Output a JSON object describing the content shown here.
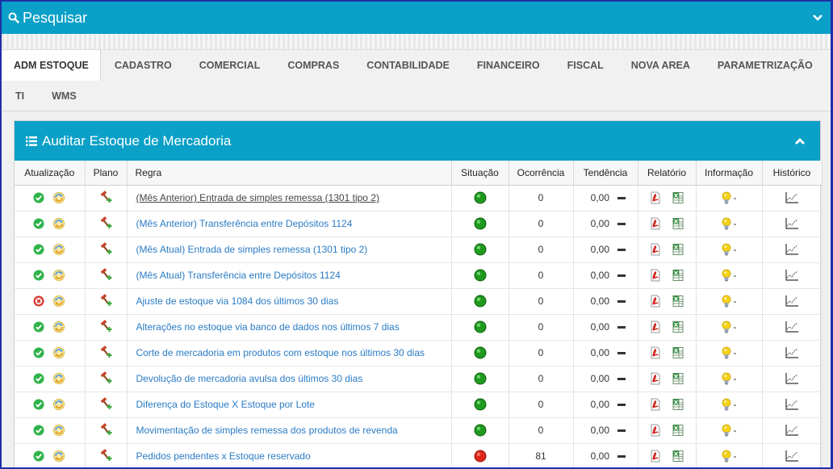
{
  "header": {
    "title": "Pesquisar"
  },
  "tabs": [
    "ADM ESTOQUE",
    "CADASTRO",
    "COMERCIAL",
    "COMPRAS",
    "CONTABILIDADE",
    "FINANCEIRO",
    "FISCAL",
    "NOVA AREA",
    "PARAMETRIZAÇÃO",
    "TI",
    "WMS"
  ],
  "active_tab": "ADM ESTOQUE",
  "panel": {
    "title": "Auditar Estoque de Mercadoria",
    "columns": [
      "Atualização",
      "Plano",
      "Regra",
      "Situação",
      "Ocorrência",
      "Tendência",
      "Relatório",
      "Informação",
      "Histórico"
    ],
    "rows": [
      {
        "status": "ok",
        "regra": "(Mês Anterior) Entrada de simples remessa (1301 tipo 2)",
        "situacao": "green",
        "ocorrencia": "0",
        "tendencia": "0,00",
        "info": "-"
      },
      {
        "status": "ok",
        "regra": "(Mês Anterior) Transferência entre Depósitos 1124",
        "situacao": "green",
        "ocorrencia": "0",
        "tendencia": "0,00",
        "info": "-"
      },
      {
        "status": "ok",
        "regra": "(Mês Atual) Entrada de simples remessa (1301 tipo 2)",
        "situacao": "green",
        "ocorrencia": "0",
        "tendencia": "0,00",
        "info": "-"
      },
      {
        "status": "ok",
        "regra": "(Mês Atual) Transferência entre Depósitos 1124",
        "situacao": "green",
        "ocorrencia": "0",
        "tendencia": "0,00",
        "info": "-"
      },
      {
        "status": "error",
        "regra": "Ajuste de estoque via 1084 dos últimos 30 dias",
        "situacao": "green",
        "ocorrencia": "0",
        "tendencia": "0,00",
        "info": "-"
      },
      {
        "status": "ok",
        "regra": "Alterações no estoque via banco de dados nos últimos 7 dias",
        "situacao": "green",
        "ocorrencia": "0",
        "tendencia": "0,00",
        "info": "-"
      },
      {
        "status": "ok",
        "regra": "Corte de mercadoria em produtos com estoque nos últimos 30 dias",
        "situacao": "green",
        "ocorrencia": "0",
        "tendencia": "0,00",
        "info": "-"
      },
      {
        "status": "ok",
        "regra": "Devolução de mercadoria avulsa dos últimos 30 dias",
        "situacao": "green",
        "ocorrencia": "0",
        "tendencia": "0,00",
        "info": "-"
      },
      {
        "status": "ok",
        "regra": "Diferença do Estoque X Estoque por Lote",
        "situacao": "green",
        "ocorrencia": "0",
        "tendencia": "0,00",
        "info": "-"
      },
      {
        "status": "ok",
        "regra": "Movimentação de simples remessa dos produtos de revenda",
        "situacao": "green",
        "ocorrencia": "0",
        "tendencia": "0,00",
        "info": "-"
      },
      {
        "status": "ok",
        "regra": "Pedidos pendentes x Estoque reservado",
        "situacao": "red",
        "ocorrencia": "81",
        "tendencia": "0,00",
        "info": "-"
      }
    ]
  },
  "colors": {
    "accent": "#0aa0c8",
    "link": "#2a7bc4",
    "ok": "#2fb34a",
    "error": "#d9342b"
  }
}
